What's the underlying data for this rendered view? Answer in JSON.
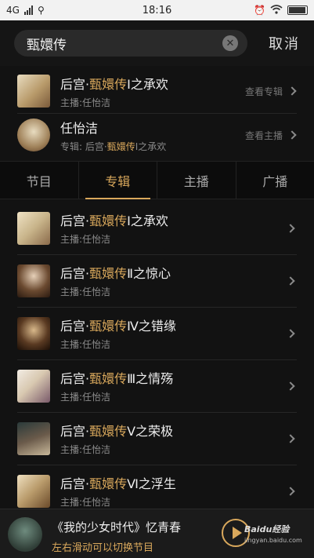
{
  "status_bar": {
    "network": "4G",
    "time": "18:16"
  },
  "search": {
    "query": "甄嬛传",
    "cancel_label": "取消"
  },
  "top_results": [
    {
      "prefix": "后宫·",
      "highlight": "甄嬛传",
      "suffix": "Ⅰ之承欢",
      "sub": "主播:任怡洁",
      "action": "查看专辑"
    },
    {
      "name": "任怡洁",
      "sub_prefix": "专辑: 后宫·",
      "sub_highlight": "甄嬛传",
      "sub_suffix": "Ⅰ之承欢",
      "action": "查看主播"
    }
  ],
  "tabs": [
    {
      "label": "节目"
    },
    {
      "label": "专辑",
      "active": true
    },
    {
      "label": "主播"
    },
    {
      "label": "广播"
    }
  ],
  "albums": [
    {
      "prefix": "后宫·",
      "highlight": "甄嬛传",
      "suffix": "Ⅰ之承欢",
      "anchor": "主播:任怡洁"
    },
    {
      "prefix": "后宫·",
      "highlight": "甄嬛传",
      "suffix": "Ⅱ之惊心",
      "anchor": "主播:任怡洁"
    },
    {
      "prefix": "后宫·",
      "highlight": "甄嬛传",
      "suffix": "Ⅳ之错缘",
      "anchor": "主播:任怡洁"
    },
    {
      "prefix": "后宫·",
      "highlight": "甄嬛传",
      "suffix": "Ⅲ之情殇",
      "anchor": "主播:任怡洁"
    },
    {
      "prefix": "后宫·",
      "highlight": "甄嬛传",
      "suffix": "Ⅴ之荣极",
      "anchor": "主播:任怡洁"
    },
    {
      "prefix": "后宫·",
      "highlight": "甄嬛传",
      "suffix": "Ⅵ之浮生",
      "anchor": "主播:任怡洁"
    }
  ],
  "player": {
    "title": "《我的少女时代》忆青春",
    "subtitle": "左右滑动可以切换节目"
  },
  "watermark": {
    "brand": "Baidu经验",
    "url": "jingyan.baidu.com"
  },
  "colors": {
    "accent": "#d9a85c",
    "background": "#121212"
  },
  "cover_colors": [
    "#c8b48a",
    "#8a6a4a",
    "#5a3a22",
    "#d8c8b0",
    "#6a5a4a",
    "#b89a6a"
  ]
}
